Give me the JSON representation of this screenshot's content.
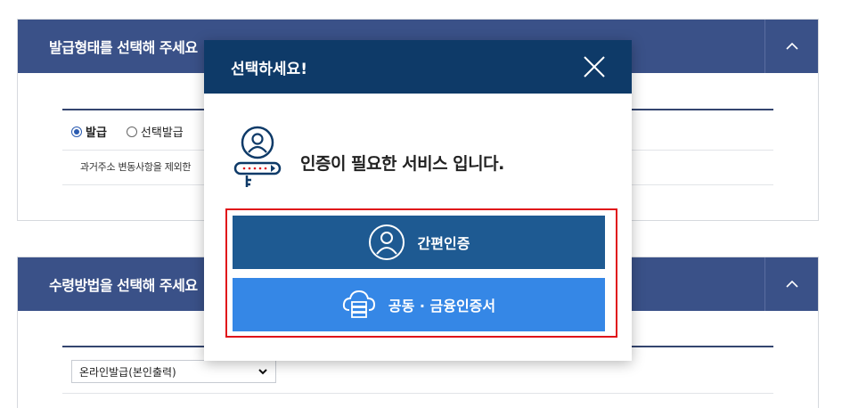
{
  "panel1": {
    "title": "발급형태를 선택해 주세요",
    "radio_issue": "발급",
    "radio_select": "선택발급",
    "note": "과거주소 변동사항을 제외한"
  },
  "panel2": {
    "title": "수령방법을 선택해 주세요",
    "select_value": "온라인발급(본인출력)"
  },
  "modal": {
    "title": "선택하세요!",
    "message": "인증이 필요한 서비스 입니다.",
    "simple_auth_label": "간편인증",
    "cert_auth_label": "공동 · 금융인증서"
  },
  "colors": {
    "panel_header": "#3a5188",
    "modal_header": "#0e3a68",
    "simple_button": "#1e5a92",
    "cert_button": "#3587e6",
    "highlight": "#e0141a"
  }
}
